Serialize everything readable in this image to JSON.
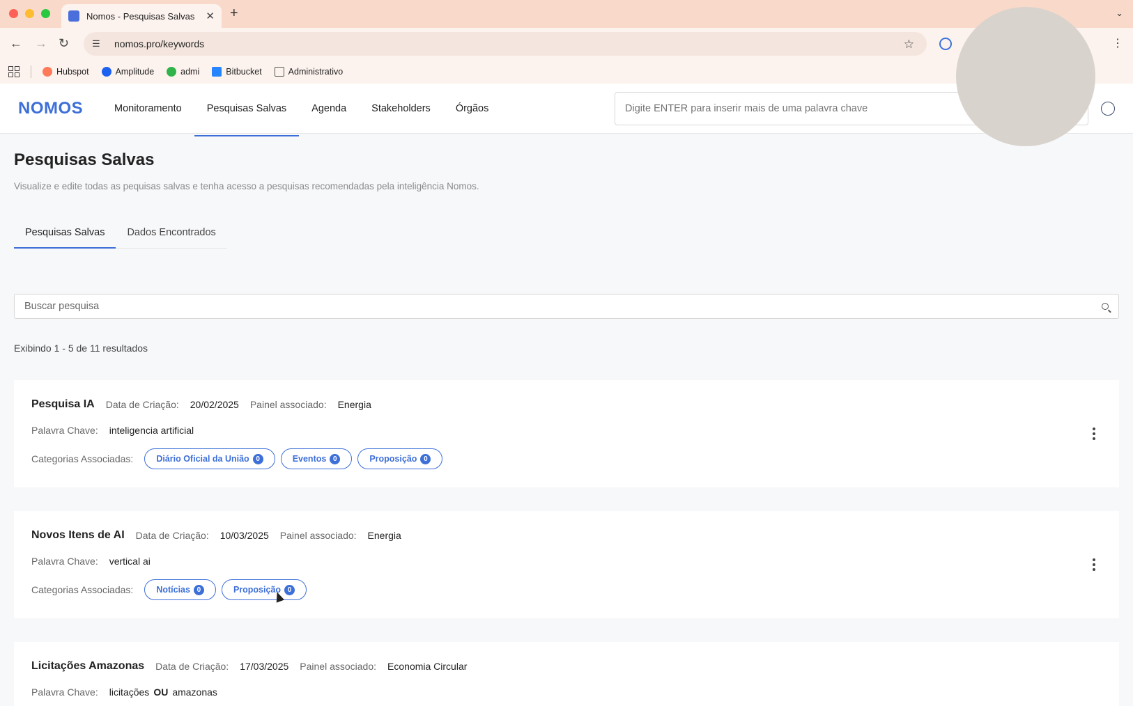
{
  "browser": {
    "tab_title": "Nomos - Pesquisas Salvas",
    "url": "nomos.pro/keywords",
    "bookmarks": [
      {
        "label": "Hubspot",
        "color": "#ff7a59"
      },
      {
        "label": "Amplitude",
        "color": "#1e61f0"
      },
      {
        "label": "admi",
        "color": "#2fb34a"
      },
      {
        "label": "Bitbucket",
        "color": "#2684ff"
      },
      {
        "label": "Administrativo",
        "color": "#555555"
      }
    ]
  },
  "header": {
    "logo": "NOMOS",
    "nav": [
      "Monitoramento",
      "Pesquisas Salvas",
      "Agenda",
      "Stakeholders",
      "Órgãos"
    ],
    "active_nav": "Pesquisas Salvas",
    "search_placeholder": "Digite ENTER para inserir mais de uma palavra chave"
  },
  "page": {
    "title": "Pesquisas Salvas",
    "description": "Visualize e edite todas as pequisas salvas e tenha acesso a pesquisas recomendadas pela inteligência Nomos.",
    "tabs": [
      "Pesquisas Salvas",
      "Dados Encontrados"
    ],
    "list_search_placeholder": "Buscar pesquisa",
    "results_count": "Exibindo 1 - 5 de 11 resultados"
  },
  "labels": {
    "created": "Data de Criação:",
    "panel": "Painel associado:",
    "keyword": "Palavra Chave:",
    "categories": "Categorias Associadas:"
  },
  "searches": [
    {
      "name": "Pesquisa IA",
      "created": "20/02/2025",
      "panel": "Energia",
      "keyword": "inteligencia artificial",
      "categories": [
        {
          "label": "Diário Oficial da União",
          "count": "0"
        },
        {
          "label": "Eventos",
          "count": "0"
        },
        {
          "label": "Proposição",
          "count": "0"
        }
      ]
    },
    {
      "name": "Novos Itens de AI",
      "created": "10/03/2025",
      "panel": "Energia",
      "keyword": "vertical ai",
      "categories": [
        {
          "label": "Notícias",
          "count": "0"
        },
        {
          "label": "Proposição",
          "count": "0"
        }
      ]
    },
    {
      "name": "Licitações Amazonas",
      "created": "17/03/2025",
      "panel": "Economia Circular",
      "keyword_parts": [
        "licitações",
        "OU",
        "amazonas"
      ]
    }
  ]
}
